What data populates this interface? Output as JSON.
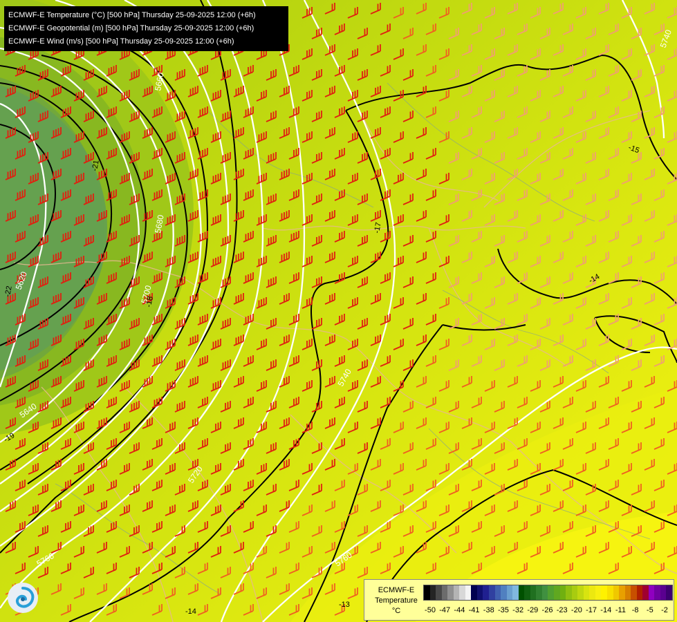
{
  "header": {
    "line1": "ECMWF-E Temperature (°C) [500 hPa] Thursday 25-09-2025 12:00 (+6h)",
    "line2": "ECMWF-E Geopotential (m) [500 hPa] Thursday 25-09-2025 12:00 (+6h)",
    "line3": "ECMWF-E Wind (m/s) [500 hPa] Thursday 25-09-2025 12:00 (+6h)"
  },
  "legend": {
    "title1": "ECMWF-E",
    "title2": "Temperature",
    "unit": "°C",
    "ticks": [
      "-50",
      "-47",
      "-44",
      "-41",
      "-38",
      "-35",
      "-32",
      "-29",
      "-26",
      "-23",
      "-20",
      "-17",
      "-14",
      "-11",
      "-8",
      "-5",
      "-2"
    ],
    "colors": [
      "#000000",
      "#242424",
      "#484848",
      "#6c6c6c",
      "#909090",
      "#b4b4b4",
      "#d8d8d8",
      "#f4f4f4",
      "#000050",
      "#101070",
      "#202090",
      "#3040a0",
      "#4060b0",
      "#5080c0",
      "#6aa0d0",
      "#80b8e0",
      "#005000",
      "#106010",
      "#207020",
      "#308030",
      "#409040",
      "#50a030",
      "#60a820",
      "#70b010",
      "#90c010",
      "#a8cc10",
      "#c0d810",
      "#d8e410",
      "#ece810",
      "#f8f010",
      "#fff200",
      "#f8e000",
      "#f0c800",
      "#e8a000",
      "#d88000",
      "#c85000",
      "#b02000",
      "#a00030",
      "#9000c0",
      "#7000a0",
      "#5a0090",
      "#3c0070"
    ]
  },
  "map": {
    "contour_labels_height": [
      {
        "text": "5620",
        "rot": -70
      },
      {
        "text": "5640",
        "rot": -35
      },
      {
        "text": "5660",
        "rot": -80
      },
      {
        "text": "5680",
        "rot": -80
      },
      {
        "text": "5700",
        "rot": -75
      },
      {
        "text": "5720",
        "rot": -55
      },
      {
        "text": "5740",
        "rot": -60
      },
      {
        "text": "5760",
        "rot": -35
      },
      {
        "text": "5760",
        "rot": -30
      },
      {
        "text": "5740",
        "rot": -70
      }
    ],
    "contour_labels_temp": [
      {
        "text": "-22",
        "rot": -80
      },
      {
        "text": "-21",
        "rot": -80
      },
      {
        "text": "-19",
        "rot": -30
      },
      {
        "text": "-18",
        "rot": -80
      },
      {
        "text": "-17",
        "rot": -80
      },
      {
        "text": "-15",
        "rot": 20
      },
      {
        "text": "-14",
        "rot": -30
      },
      {
        "text": "-14",
        "rot": 0
      },
      {
        "text": "-13",
        "rot": 0
      }
    ]
  }
}
